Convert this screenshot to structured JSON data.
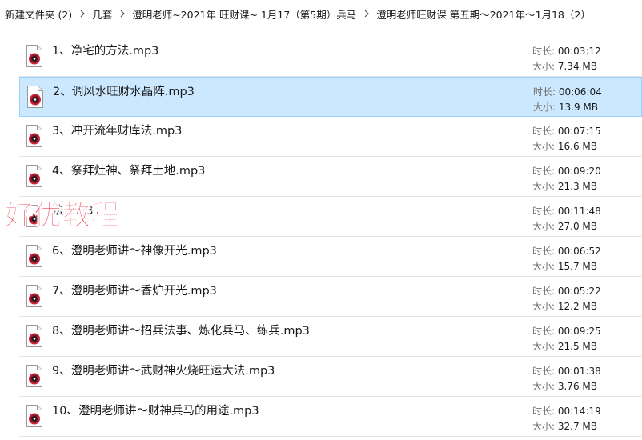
{
  "breadcrumb": [
    "新建文件夹 (2)",
    "几套",
    "澄明老师~2021年 旺财课~ 1月17（第5期）兵马",
    "澄明老师旺财课   第五期～2021年～1月18（2）"
  ],
  "labels": {
    "duration": "时长: ",
    "size": "大小: "
  },
  "files": [
    {
      "name": "1、净宅的方法.mp3",
      "duration": "00:03:12",
      "size": "7.34 MB"
    },
    {
      "name": "2、调风水旺财水晶阵.mp3",
      "duration": "00:06:04",
      "size": "13.9 MB"
    },
    {
      "name": "3、冲开流年财库法.mp3",
      "duration": "00:07:15",
      "size": "16.6 MB"
    },
    {
      "name": "4、祭拜灶神、祭拜土地.mp3",
      "duration": "00:09:20",
      "size": "21.3 MB"
    },
    {
      "name": "法.mp3",
      "duration": "00:11:48",
      "size": "27.0 MB"
    },
    {
      "name": "6、澄明老师讲～神像开光.mp3",
      "duration": "00:06:52",
      "size": "15.7 MB"
    },
    {
      "name": "7、澄明老师讲～香炉开光.mp3",
      "duration": "00:05:22",
      "size": "12.2 MB"
    },
    {
      "name": "8、澄明老师讲～招兵法事、炼化兵马、练兵.mp3",
      "duration": "00:09:25",
      "size": "21.5 MB"
    },
    {
      "name": "9、澄明老师讲～武财神火烧旺运大法.mp3",
      "duration": "00:01:38",
      "size": "3.76 MB"
    },
    {
      "name": "10、澄明老师讲～财神兵马的用途.mp3",
      "duration": "00:14:19",
      "size": "32.7 MB"
    }
  ],
  "selected_index": 1,
  "watermark": "好优教程",
  "colors": {
    "selection_bg": "#cce8ff",
    "selection_border": "#99d1ff",
    "watermark": "#e8192c",
    "icon_disc": "#c7283c"
  },
  "icons": {
    "file": "media-audio-file-icon",
    "separator": "chevron-right-icon"
  }
}
